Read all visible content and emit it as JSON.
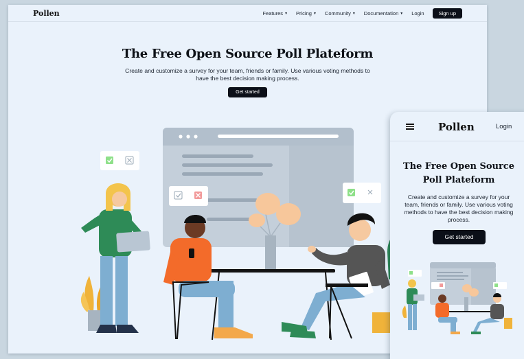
{
  "desktop": {
    "logo": "Pollen",
    "nav": {
      "features": "Features",
      "pricing": "Pricing",
      "community": "Community",
      "documentation": "Documentation",
      "login": "Login",
      "signup": "Sign up"
    },
    "hero": {
      "title": "The Free Open Source Poll Plateform",
      "subtitle": "Create and customize a survey for your team, friends or family. Use various voting methods to have the best decision making process.",
      "cta": "Get started"
    }
  },
  "mobile": {
    "logo": "Pollen",
    "login": "Login",
    "hero": {
      "title": "The Free Open Source Poll Plateform",
      "subtitle": "Create and customize a survey for your team, friends or family. Use various voting methods to have the best decision making process.",
      "cta": "Get started"
    }
  },
  "colors": {
    "background": "#eaf2fb",
    "button": "#0b0f18",
    "check_green": "#8ee089",
    "cross_red": "#f29a9a",
    "shirt_green": "#2e8b57",
    "shirt_orange": "#f36b2a",
    "shirt_gray": "#555555",
    "jeans_blue": "#7eaed1"
  },
  "icons": [
    "chevron-down-icon",
    "hamburger-menu-icon",
    "checkbox-checked-icon",
    "checkbox-cross-icon"
  ]
}
